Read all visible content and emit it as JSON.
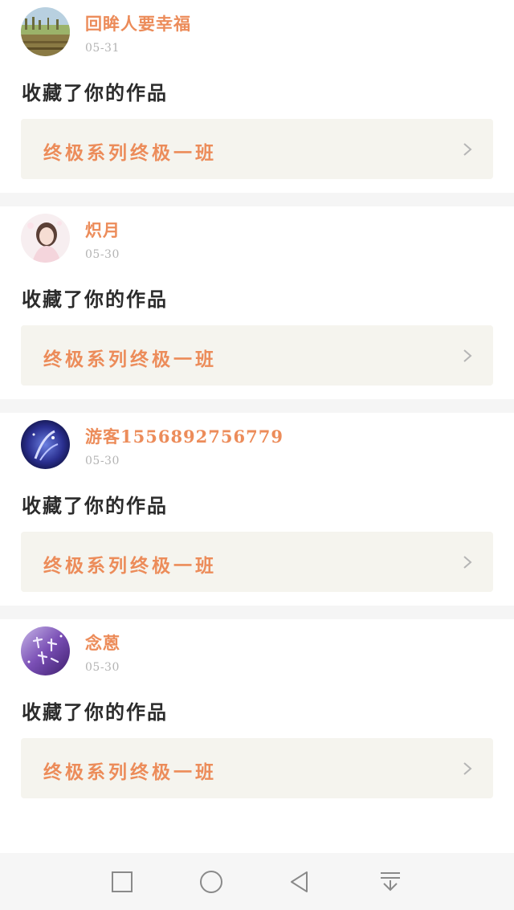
{
  "notifications": [
    {
      "username": "回眸人要幸福",
      "date": "05-31",
      "action": "收藏了你的作品",
      "work_title": "终极系列终极一班",
      "avatar": "landscape-field"
    },
    {
      "username": "炽月",
      "date": "05-30",
      "action": "收藏了你的作品",
      "work_title": "终极系列终极一班",
      "avatar": "girl-portrait"
    },
    {
      "username": "游客1556892756779",
      "date": "05-30",
      "action": "收藏了你的作品",
      "work_title": "终极系列终极一班",
      "avatar": "blue-galaxy-art"
    },
    {
      "username": "念蒽",
      "date": "05-30",
      "action": "收藏了你的作品",
      "work_title": "终极系列终极一班",
      "avatar": "purple-calligraphy"
    }
  ],
  "colors": {
    "accent": "#ec8c5a",
    "date": "#b3b3b3",
    "text": "#2b2b2b",
    "link_bg": "#f5f4ee",
    "separator": "#f5f5f5",
    "navbar_bg": "#f6f6f6"
  },
  "navbar": {
    "buttons": [
      "recents-square-icon",
      "home-circle-icon",
      "back-triangle-icon",
      "notification-pull-down-icon"
    ]
  }
}
